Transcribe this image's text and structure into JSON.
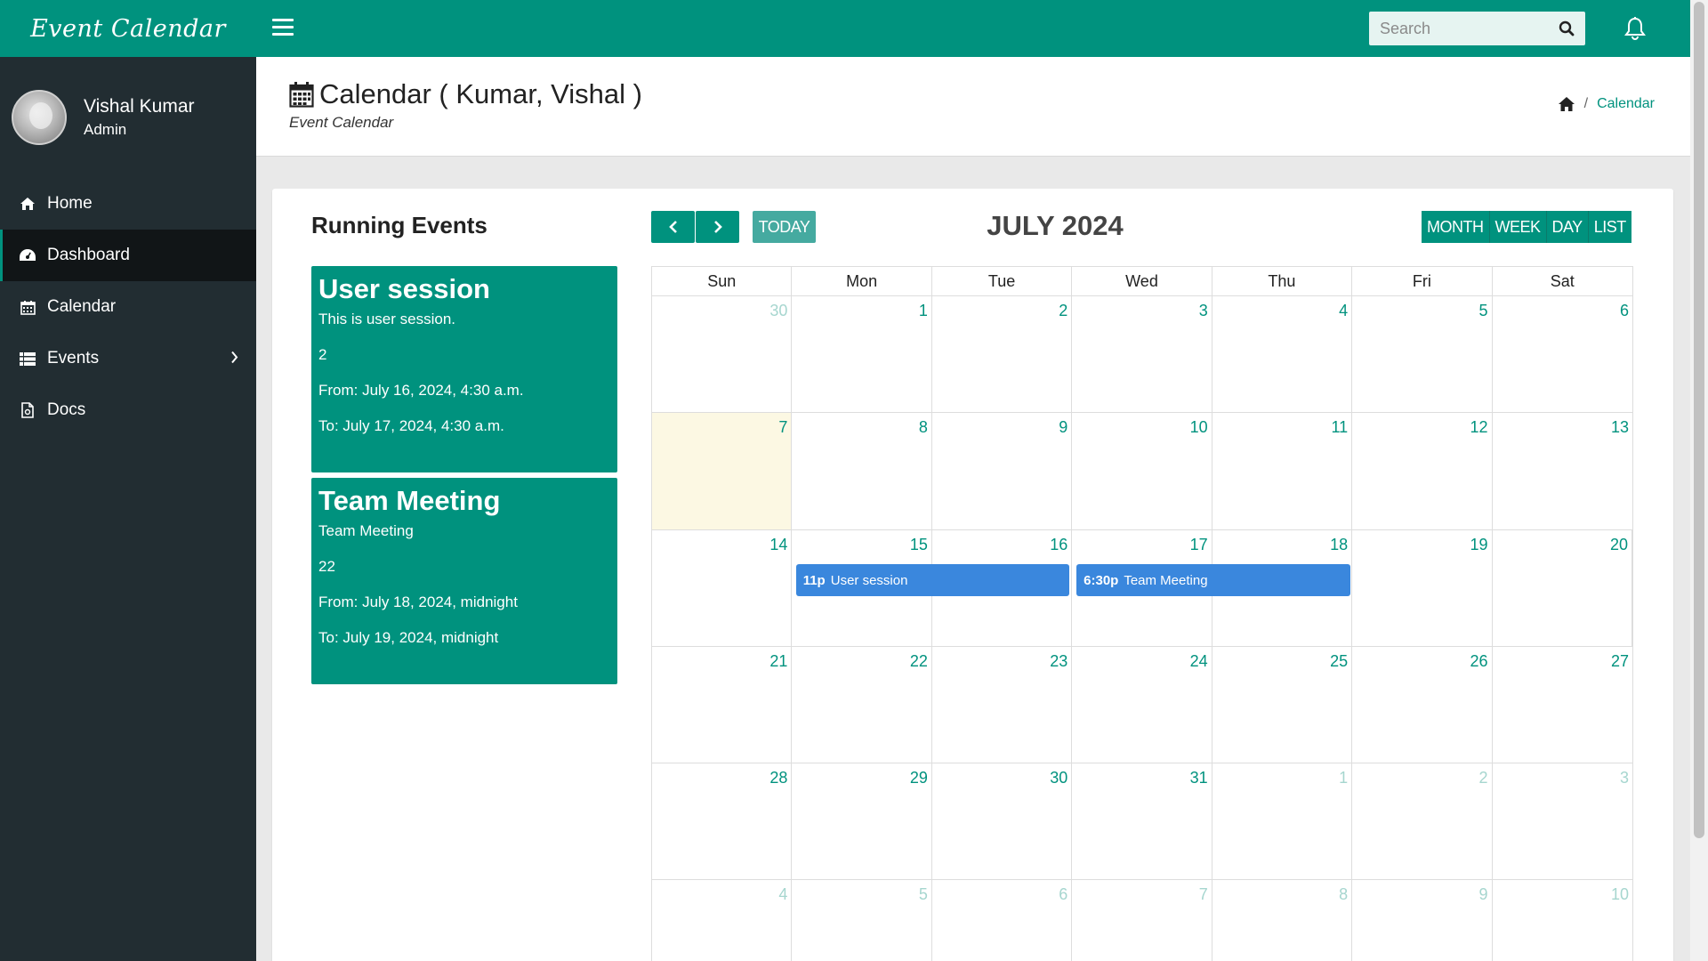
{
  "brand": "Event Calendar",
  "user": {
    "name": "Vishal Kumar",
    "role": "Admin"
  },
  "nav": [
    {
      "label": "Home",
      "icon": "home-icon"
    },
    {
      "label": "Dashboard",
      "icon": "dashboard-icon"
    },
    {
      "label": "Calendar",
      "icon": "calendar-icon"
    },
    {
      "label": "Events",
      "icon": "list-icon"
    },
    {
      "label": "Docs",
      "icon": "docs-icon"
    }
  ],
  "search": {
    "placeholder": "Search"
  },
  "header": {
    "title": "Calendar ( Kumar, Vishal )",
    "subtitle": "Event Calendar",
    "breadcrumb": "Calendar"
  },
  "running": {
    "title": "Running Events",
    "events": [
      {
        "title": "User session",
        "description": "This is user session.",
        "id": "2",
        "from": "From: July 16, 2024, 4:30 a.m.",
        "to": "To: July 17, 2024, 4:30 a.m."
      },
      {
        "title": "Team Meeting",
        "description": "Team Meeting",
        "id": "22",
        "from": "From: July 18, 2024, midnight",
        "to": "To: July 19, 2024, midnight"
      }
    ]
  },
  "calendar": {
    "today_label": "TODAY",
    "month_title": "JULY 2024",
    "views": [
      "MONTH",
      "WEEK",
      "DAY",
      "LIST"
    ],
    "weekdays": [
      "Sun",
      "Mon",
      "Tue",
      "Wed",
      "Thu",
      "Fri",
      "Sat"
    ],
    "weeks": [
      [
        "30",
        "1",
        "2",
        "3",
        "4",
        "5",
        "6"
      ],
      [
        "7",
        "8",
        "9",
        "10",
        "11",
        "12",
        "13"
      ],
      [
        "14",
        "15",
        "16",
        "17",
        "18",
        "19",
        "20"
      ],
      [
        "21",
        "22",
        "23",
        "24",
        "25",
        "26",
        "27"
      ],
      [
        "28",
        "29",
        "30",
        "31",
        "1",
        "2",
        "3"
      ],
      [
        "4",
        "5",
        "6",
        "7",
        "8",
        "9",
        "10"
      ]
    ],
    "other_month": [
      [
        true,
        false,
        false,
        false,
        false,
        false,
        false
      ],
      [
        false,
        false,
        false,
        false,
        false,
        false,
        false
      ],
      [
        false,
        false,
        false,
        false,
        false,
        false,
        false
      ],
      [
        false,
        false,
        false,
        false,
        false,
        false,
        false
      ],
      [
        false,
        false,
        false,
        false,
        true,
        true,
        true
      ],
      [
        true,
        true,
        true,
        true,
        true,
        true,
        true
      ]
    ],
    "today": "7",
    "events": [
      {
        "time": "11p",
        "title": "User session",
        "start": "15",
        "end": "16"
      },
      {
        "time": "6:30p",
        "title": "Team Meeting",
        "start": "17",
        "end": "18"
      }
    ]
  },
  "colors": {
    "primary": "#00927e",
    "sidebar": "#222d32",
    "event": "#3a87dd",
    "today_bg": "#fcf8e3"
  }
}
